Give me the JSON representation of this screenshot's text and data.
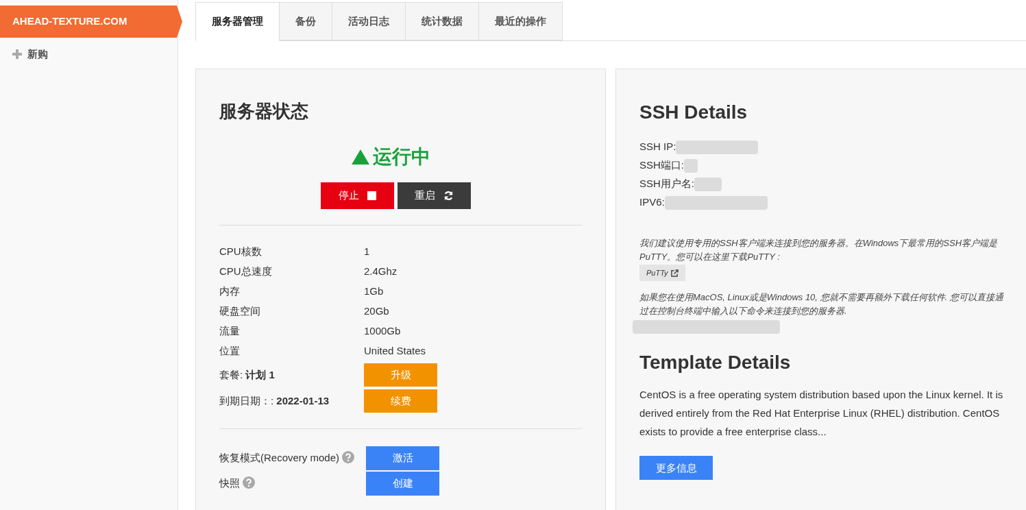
{
  "sidebar": {
    "domain": "AHEAD-TEXTURE.COM",
    "items": [
      {
        "label": "新购"
      }
    ]
  },
  "tabs": [
    {
      "label": "服务器管理",
      "selected": true
    },
    {
      "label": "备份",
      "selected": false
    },
    {
      "label": "活动日志",
      "selected": false
    },
    {
      "label": "统计数据",
      "selected": false
    },
    {
      "label": "最近的操作",
      "selected": false
    }
  ],
  "server_status": {
    "title": "服务器状态",
    "status": "运行中",
    "running": true,
    "buttons": [
      {
        "label": "停止",
        "kind": "stop"
      },
      {
        "label": "重启",
        "kind": "restart"
      }
    ],
    "specs": [
      {
        "label": "CPU核数",
        "value": "1"
      },
      {
        "label": "CPU总速度",
        "value": "2.4Ghz"
      },
      {
        "label": "内存",
        "value": "1Gb"
      },
      {
        "label": "硬盘空间",
        "value": "20Gb"
      },
      {
        "label": "流量",
        "value": "1000Gb"
      },
      {
        "label": "位置",
        "value": "United States"
      }
    ],
    "plan": {
      "label": "套餐: ",
      "value": "计划 1",
      "button": "升级"
    },
    "expiry": {
      "label": "到期日期：: ",
      "value": "2022-01-13",
      "button": "续费"
    },
    "actions": [
      {
        "label": "恢复模式(Recovery mode)",
        "button": "激活"
      },
      {
        "label": "快照",
        "button": "创建"
      }
    ]
  },
  "ssh": {
    "title": "SSH Details",
    "fields": [
      {
        "label": "SSH IP:"
      },
      {
        "label": "SSH端口:"
      },
      {
        "label": "SSH用户名:"
      },
      {
        "label": "IPV6:"
      }
    ],
    "note1": "我们建议使用专用的SSH客户端来连接到您的服务器。在Windows下最常用的SSH客户端是PuTTY。您可以在这里下载PuTTY :",
    "putty": "PuTTy",
    "note2": "如果您在使用MacOS, Linux或是Windows 10, 您就不需要再额外下载任何软件. 您可以直接通过在控制台终端中输入以下命令来连接到您的服务器."
  },
  "template": {
    "title": "Template Details",
    "description": "CentOS is a free operating system distribution based upon the Linux kernel. It is derived entirely from the Red Hat Enterprise Linux (RHEL) distribution. CentOS exists to provide a free enterprise class...",
    "button": "更多信息"
  }
}
